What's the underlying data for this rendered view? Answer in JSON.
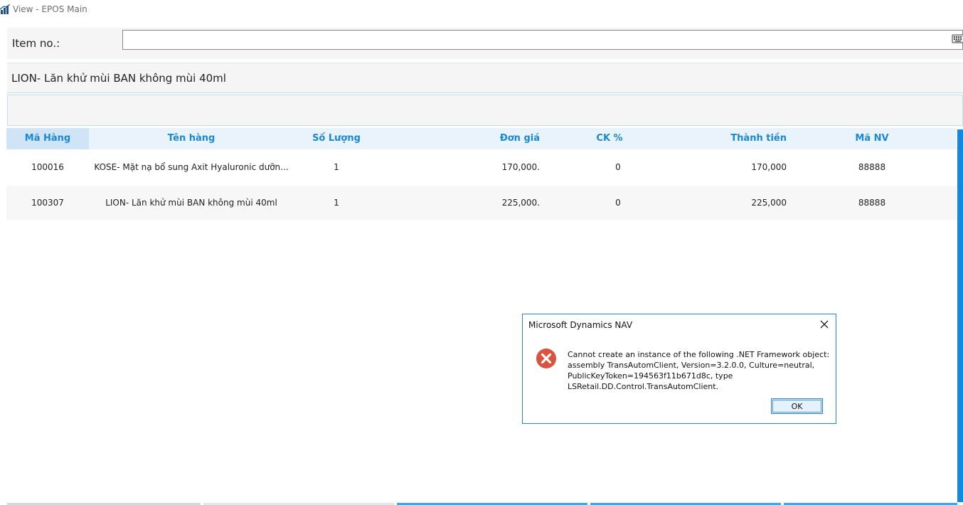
{
  "window": {
    "title": "View - EPOS Main",
    "icon": "app-chart-icon"
  },
  "item_entry": {
    "label": "Item no.:",
    "value": "",
    "keyboard_icon": "keyboard-icon"
  },
  "selected_item": {
    "description": "LION- Lăn khử mùi BAN không mùi 40ml"
  },
  "grid": {
    "columns": [
      "Mã Hàng",
      "Tên hàng",
      "Số Lượng",
      "Đơn giá",
      "CK %",
      "Thành tiền",
      "Mã NV"
    ],
    "rows": [
      {
        "code": "100016",
        "name": "KOSE- Mặt nạ bổ sung Axit Hyaluronic dưỡn...",
        "qty": "1",
        "unit_price": "170,000.",
        "discount": "0",
        "amount": "170,000",
        "staff": "88888"
      },
      {
        "code": "100307",
        "name": "LION- Lăn khử mùi BAN không mùi 40ml",
        "qty": "1",
        "unit_price": "225,000.",
        "discount": "0",
        "amount": "225,000",
        "staff": "88888"
      }
    ]
  },
  "dialog": {
    "title": "Microsoft Dynamics NAV",
    "icon": "error-icon",
    "message_lines": [
      "Cannot create an instance of the following .NET Framework object:",
      "assembly TransAutomClient, Version=3.2.0.0, Culture=neutral,",
      "PublicKeyToken=194563f11b671d8c, type",
      "LSRetail.DD.Control.TransAutomClient."
    ],
    "ok_label": "OK"
  },
  "colors": {
    "accent": "#1587dd",
    "header_text": "#1a88d4",
    "header_bg": "#e9f3fb",
    "error_red": "#d9543f"
  }
}
